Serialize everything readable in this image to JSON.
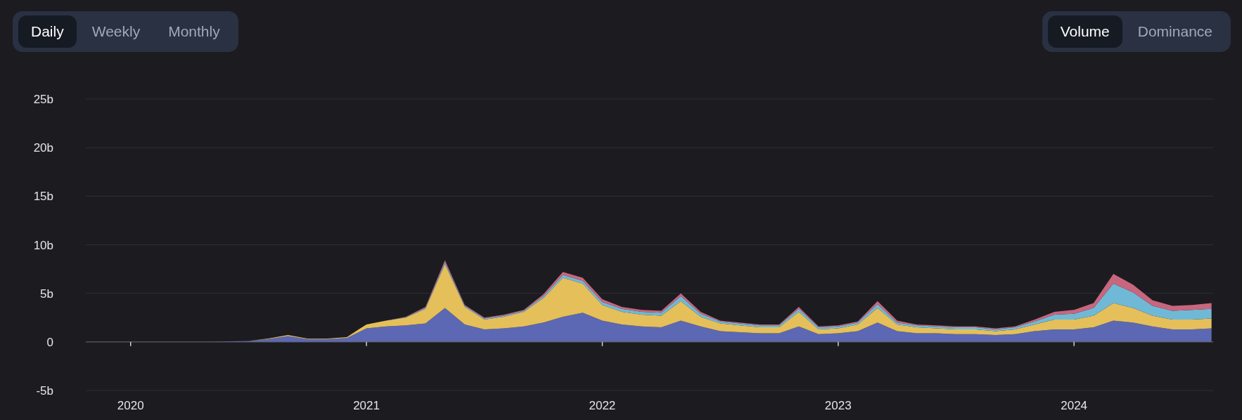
{
  "period_tabs": [
    {
      "label": "Daily",
      "selected": true
    },
    {
      "label": "Weekly",
      "selected": false
    },
    {
      "label": "Monthly",
      "selected": false
    }
  ],
  "metric_tabs": [
    {
      "label": "Volume",
      "selected": true
    },
    {
      "label": "Dominance",
      "selected": false
    }
  ],
  "chart": {
    "chart_data": {
      "type": "area",
      "stacked": true,
      "grid": true,
      "x": [
        2019.833,
        2019.917,
        2020.0,
        2020.083,
        2020.167,
        2020.25,
        2020.333,
        2020.417,
        2020.5,
        2020.583,
        2020.667,
        2020.75,
        2020.833,
        2020.917,
        2021.0,
        2021.083,
        2021.167,
        2021.25,
        2021.333,
        2021.417,
        2021.5,
        2021.583,
        2021.667,
        2021.75,
        2021.833,
        2021.917,
        2022.0,
        2022.083,
        2022.167,
        2022.25,
        2022.333,
        2022.417,
        2022.5,
        2022.583,
        2022.667,
        2022.75,
        2022.833,
        2022.917,
        2023.0,
        2023.083,
        2023.167,
        2023.25,
        2023.333,
        2023.417,
        2023.5,
        2023.583,
        2023.667,
        2023.75,
        2023.833,
        2023.917,
        2024.0,
        2024.083,
        2024.167,
        2024.25,
        2024.333,
        2024.417,
        2024.5,
        2024.583
      ],
      "series": [
        {
          "color": "#5c68b4",
          "values": [
            0,
            0,
            0,
            0,
            0,
            0,
            0,
            0.05,
            0.1,
            0.3,
            0.6,
            0.3,
            0.3,
            0.4,
            1.4,
            1.6,
            1.7,
            1.9,
            3.5,
            1.8,
            1.3,
            1.4,
            1.6,
            2.0,
            2.6,
            3.0,
            2.2,
            1.8,
            1.6,
            1.5,
            2.2,
            1.6,
            1.1,
            1.0,
            0.9,
            0.9,
            1.6,
            0.8,
            0.9,
            1.1,
            2.0,
            1.1,
            0.9,
            0.9,
            0.8,
            0.8,
            0.7,
            0.8,
            1.1,
            1.3,
            1.3,
            1.5,
            2.2,
            2.0,
            1.6,
            1.3,
            1.3,
            1.4
          ]
        },
        {
          "color": "#e5bf5a",
          "values": [
            0,
            0,
            0,
            0,
            0,
            0,
            0,
            0,
            0,
            0.05,
            0.1,
            0.05,
            0.05,
            0.1,
            0.4,
            0.6,
            0.8,
            1.5,
            4.5,
            1.8,
            1.0,
            1.2,
            1.5,
            2.5,
            4.0,
            3.0,
            1.6,
            1.3,
            1.2,
            1.2,
            2.0,
            1.0,
            0.8,
            0.7,
            0.6,
            0.6,
            1.5,
            0.5,
            0.5,
            0.7,
            1.5,
            0.7,
            0.6,
            0.5,
            0.5,
            0.5,
            0.4,
            0.5,
            0.7,
            1.0,
            1.0,
            1.2,
            1.8,
            1.5,
            1.1,
            1.0,
            1.0,
            1.0
          ]
        },
        {
          "color": "#6fb9d6",
          "values": [
            0,
            0,
            0,
            0,
            0,
            0,
            0,
            0,
            0,
            0,
            0,
            0,
            0,
            0,
            0,
            0,
            0.05,
            0.1,
            0.2,
            0.1,
            0.1,
            0.1,
            0.1,
            0.2,
            0.3,
            0.3,
            0.3,
            0.3,
            0.3,
            0.3,
            0.5,
            0.3,
            0.2,
            0.2,
            0.2,
            0.2,
            0.3,
            0.2,
            0.2,
            0.2,
            0.4,
            0.2,
            0.2,
            0.2,
            0.2,
            0.2,
            0.2,
            0.2,
            0.3,
            0.5,
            0.6,
            0.8,
            2.0,
            1.6,
            1.0,
            0.9,
            1.0,
            1.0
          ]
        },
        {
          "color": "#c8667e",
          "values": [
            0,
            0,
            0,
            0,
            0,
            0,
            0,
            0,
            0,
            0,
            0,
            0,
            0,
            0,
            0,
            0,
            0.05,
            0.1,
            0.2,
            0.1,
            0.1,
            0.1,
            0.1,
            0.2,
            0.3,
            0.3,
            0.3,
            0.2,
            0.2,
            0.2,
            0.3,
            0.2,
            0.1,
            0.1,
            0.1,
            0.1,
            0.2,
            0.1,
            0.1,
            0.1,
            0.3,
            0.2,
            0.1,
            0.1,
            0.1,
            0.1,
            0.1,
            0.1,
            0.2,
            0.3,
            0.4,
            0.5,
            1.0,
            0.8,
            0.6,
            0.5,
            0.5,
            0.6
          ]
        }
      ],
      "xlim": [
        2019.81,
        2024.59
      ],
      "ylim": [
        -5,
        25
      ],
      "xticks": [
        {
          "value": 2020,
          "label": "2020"
        },
        {
          "value": 2021,
          "label": "2021"
        },
        {
          "value": 2022,
          "label": "2022"
        },
        {
          "value": 2023,
          "label": "2023"
        },
        {
          "value": 2024,
          "label": "2024"
        }
      ],
      "yticks": [
        {
          "value": -5,
          "label": "-5b"
        },
        {
          "value": 0,
          "label": "0"
        },
        {
          "value": 5,
          "label": "5b"
        },
        {
          "value": 10,
          "label": "10b"
        },
        {
          "value": 15,
          "label": "15b"
        },
        {
          "value": 20,
          "label": "20b"
        },
        {
          "value": 25,
          "label": "25b"
        }
      ]
    }
  }
}
